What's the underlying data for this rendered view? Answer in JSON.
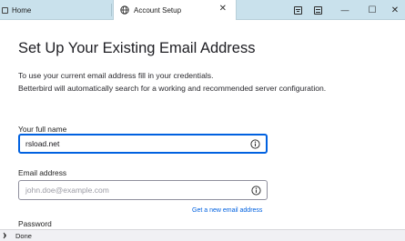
{
  "tabs": [
    {
      "label": "Home"
    },
    {
      "label": "Account Setup"
    }
  ],
  "window_buttons": {
    "minimize": "—",
    "maximize": "☐",
    "close": "✕"
  },
  "tab_close": "✕",
  "page": {
    "title": "Set Up Your Existing Email Address",
    "intro_line1": "To use your current email address fill in your credentials.",
    "intro_line2": "Betterbird will automatically search for a working and recommended server configuration."
  },
  "form": {
    "full_name_label": "Your full name",
    "full_name_value": "rsload.net",
    "email_label": "Email address",
    "email_placeholder": "john.doe@example.com",
    "new_email_link": "Get a new email address",
    "password_label": "Password"
  },
  "status": {
    "text": "Done"
  },
  "colors": {
    "tab_strip": "#c9e1ec",
    "accent": "#0061e0"
  }
}
